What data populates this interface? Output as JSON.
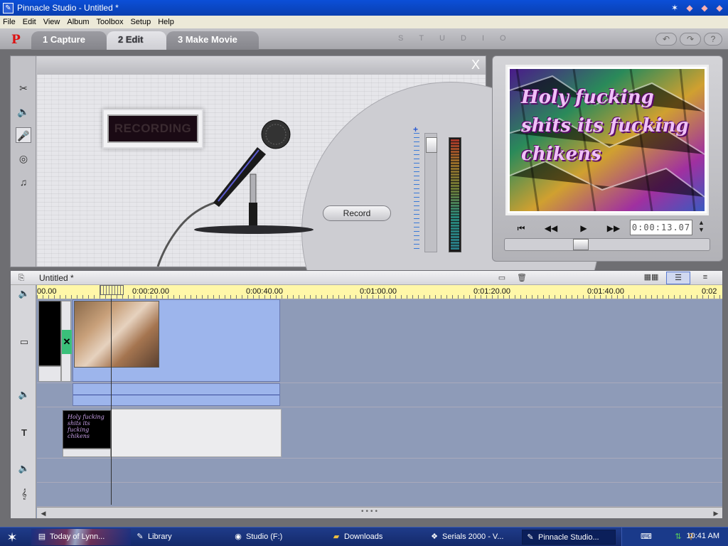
{
  "window": {
    "title": "Pinnacle Studio - Untitled *"
  },
  "menu": [
    "File",
    "Edit",
    "View",
    "Album",
    "Toolbox",
    "Setup",
    "Help"
  ],
  "tabs": [
    {
      "label": "1 Capture",
      "active": false
    },
    {
      "label": "2 Edit",
      "active": true
    },
    {
      "label": "3 Make Movie",
      "active": false
    }
  ],
  "branding": {
    "logo": "P",
    "studio_text": "STUDIO"
  },
  "toolbox": {
    "recording_label": "RECORDING",
    "record_button": "Record",
    "slider_plus": "+",
    "close_label": "X"
  },
  "player": {
    "timecode": "0:00:13.07",
    "overlay_text": "Holy fucking shits its fucking chikens"
  },
  "timeline": {
    "title": "Untitled *",
    "ruler_labels": [
      "00.00",
      "0:00:20.00",
      "0:00:40.00",
      "0:01:00.00",
      "0:01:20.00",
      "0:01:40.00",
      "0:02"
    ],
    "title_thumb_text": "Holy fucking shits its fucking chikens"
  },
  "taskbar": {
    "items": [
      {
        "label": "Today of Lynn...",
        "active": false
      },
      {
        "label": "Library",
        "active": false
      },
      {
        "label": "Studio (F:)",
        "active": false
      },
      {
        "label": "Downloads",
        "active": false
      },
      {
        "label": "Serials 2000 - V...",
        "active": false
      },
      {
        "label": "Pinnacle Studio...",
        "active": true
      }
    ],
    "clock": "10:41 AM"
  }
}
